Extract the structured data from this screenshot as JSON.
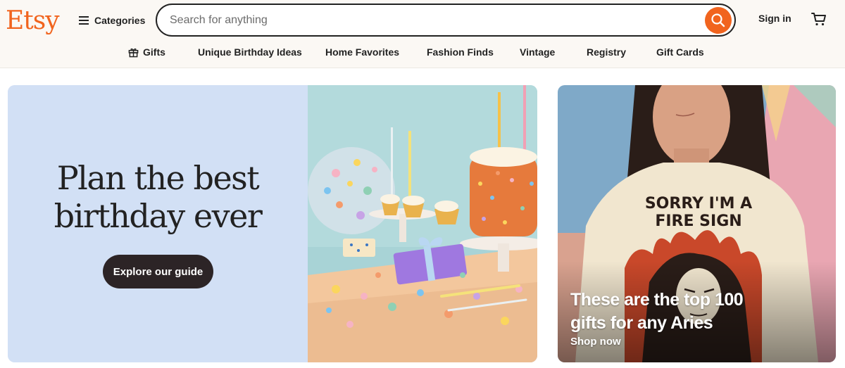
{
  "brand": {
    "logo_text": "Etsy",
    "accent_color": "#f1641e"
  },
  "header": {
    "categories_label": "Categories",
    "categories_icon": "menu-icon",
    "search": {
      "placeholder": "Search for anything",
      "value": "",
      "button_icon": "search-icon"
    },
    "signin_label": "Sign in",
    "cart_icon": "cart-icon"
  },
  "nav": {
    "items": [
      {
        "label": "Gifts",
        "icon": "gift-icon"
      },
      {
        "label": "Unique Birthday Ideas"
      },
      {
        "label": "Home Favorites"
      },
      {
        "label": "Fashion Finds"
      },
      {
        "label": "Vintage"
      },
      {
        "label": "Registry"
      },
      {
        "label": "Gift Cards"
      }
    ]
  },
  "hero": {
    "title_line1": "Plan the best",
    "title_line2": "birthday ever",
    "button_label": "Explore our guide",
    "background_color": "#d2e0f5"
  },
  "promo": {
    "shirt_text_line1": "SORRY I'M A",
    "shirt_text_line2": "FIRE SIGN",
    "text_line1": "These are the top 100",
    "text_line2": "gifts for any Aries",
    "link_label": "Shop now"
  }
}
